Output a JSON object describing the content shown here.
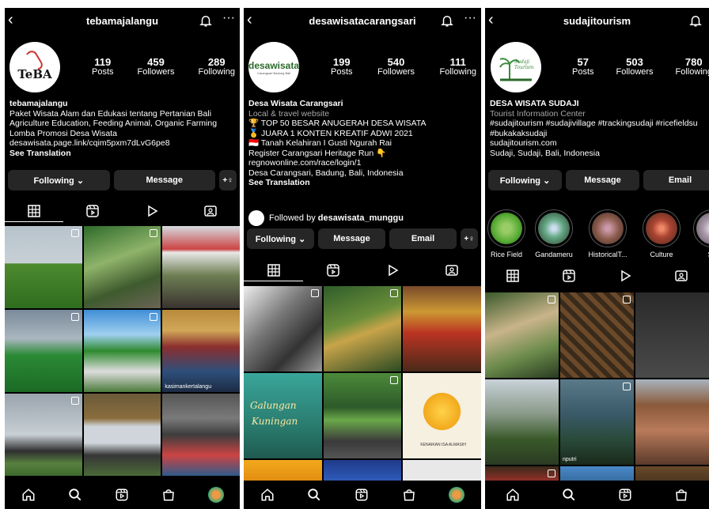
{
  "panel1": {
    "username": "tebamajalangu",
    "stats": [
      {
        "n": "119",
        "label": "Posts"
      },
      {
        "n": "459",
        "label": "Followers"
      },
      {
        "n": "289",
        "label": "Following"
      }
    ],
    "logo_text": "TeBA",
    "name": "tebamajalangu",
    "bio": [
      "Paket Wisata Alam dan Edukasi tentang Pertanian Bali",
      "Agriculture Education, Feeding Animal, Organic Farming",
      "Lomba Promosi Desa Wisata",
      "desawisata.page.link/cqim5pxm7dLvG6pe8"
    ],
    "see_translation": "See Translation",
    "btn_following": "Following ⌄",
    "btn_message": "Message",
    "btn_more": "+♀",
    "tile_caption": "kasimankertalangu"
  },
  "panel2": {
    "username": "desawisatacarangsari",
    "stats": [
      {
        "n": "199",
        "label": "Posts"
      },
      {
        "n": "540",
        "label": "Followers"
      },
      {
        "n": "111",
        "label": "Following"
      }
    ],
    "logo_text": "desawisata",
    "logo_sub": "Carangsari Badung Bali",
    "name": "Desa Wisata Carangsari",
    "category": "Local & travel website",
    "bio": [
      "🏆 TOP 50 BESAR ANUGERAH DESA WISATA",
      "🥇 JUARA 1 KONTEN KREATIF ADWI 2021",
      "🇮🇩 Tanah Kelahiran I Gusti Ngurah Rai",
      "Register Carangsari Heritage Run 👇",
      "regnowonline.com/race/login/1",
      "Desa Carangsari, Badung, Bali, Indonesia"
    ],
    "see_translation": "See Translation",
    "followed_prefix": "Followed by ",
    "followed_name": "desawisata_munggu",
    "btn_following": "Following ⌄",
    "btn_message": "Message",
    "btn_email": "Email",
    "btn_more": "+♀",
    "tile_text_1": "Galungan",
    "tile_text_2": "Kuningan",
    "tile_text_3": "KENAIKAN ISA ALMASIH"
  },
  "panel3": {
    "username": "sudajitourism",
    "stats": [
      {
        "n": "57",
        "label": "Posts"
      },
      {
        "n": "503",
        "label": "Followers"
      },
      {
        "n": "780",
        "label": "Following"
      }
    ],
    "logo_text": "Sudaji Tourism",
    "name": "DESA WISATA SUDAJI",
    "category": "Tourist Information Center",
    "bio": [
      "#sudajitourism #sudajivillage #trackingsudaji #ricefieldsu",
      "#bukakaksudaji",
      "sudajitourism.com",
      "Sudaji, Sudaji, Bali, Indonesia"
    ],
    "btn_following": "Following ⌄",
    "btn_message": "Message",
    "btn_email": "Email",
    "highlights": [
      "Rice Field",
      "Gandameru",
      "HistoricalT...",
      "Culture",
      "So"
    ],
    "tile_caption": "nputri"
  }
}
